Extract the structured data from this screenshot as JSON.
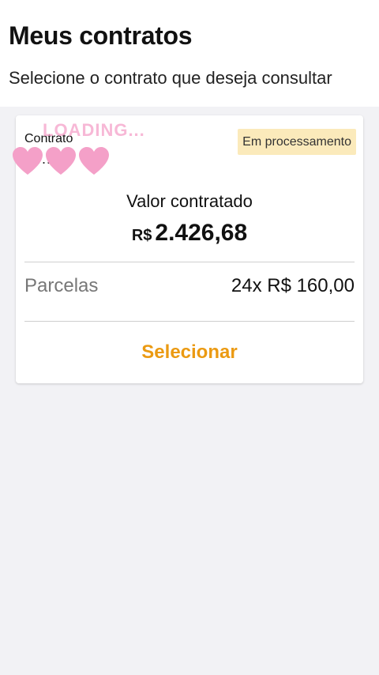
{
  "header": {
    "title": "Meus contratos",
    "subtitle": "Selecione o contrato que deseja consultar"
  },
  "contract_card": {
    "contract_label": "Contrato",
    "contract_number": "34...09",
    "status_badge": "Em processamento",
    "value_label": "Valor contratado",
    "value_currency": "R$",
    "value_amount": "2.426,68",
    "installments_label": "Parcelas",
    "installments_value": "24x R$ 160,00",
    "select_label": "Selecionar"
  },
  "overlay": {
    "loading_text": "LOADING...",
    "heart_icon": "heart-icon",
    "heart_color": "#f4a0c8"
  },
  "colors": {
    "accent": "#eb9a12",
    "badge_background": "#fbeabb",
    "page_background": "#f2f2f5"
  }
}
